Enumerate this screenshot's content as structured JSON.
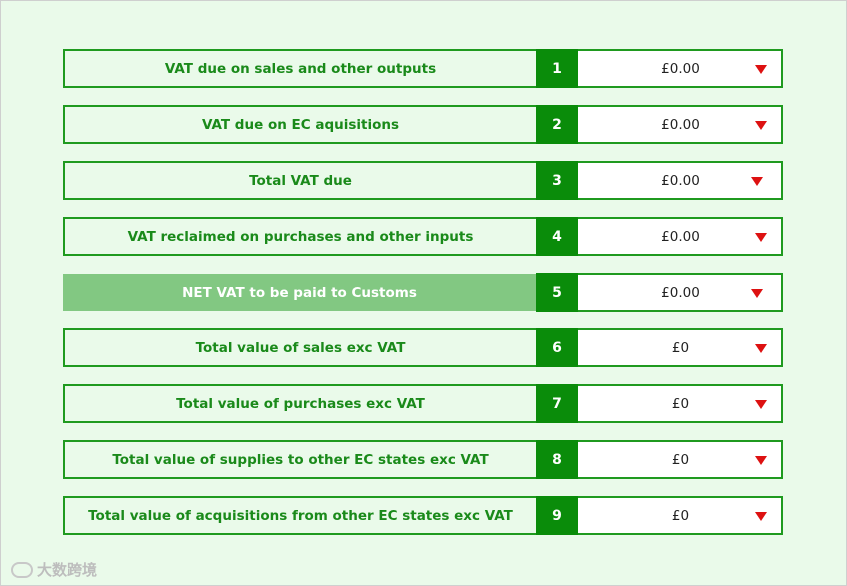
{
  "rows": [
    {
      "label": "VAT due on sales and other outputs",
      "number": "1",
      "value": "£0.00"
    },
    {
      "label": "VAT due on EC aquisitions",
      "number": "2",
      "value": "£0.00"
    },
    {
      "label": "Total VAT due",
      "number": "3",
      "value": "£0.00"
    },
    {
      "label": "VAT reclaimed on purchases and other inputs",
      "number": "4",
      "value": "£0.00"
    },
    {
      "label": "NET VAT to be paid to Customs",
      "number": "5",
      "value": "£0.00"
    },
    {
      "label": "Total value of sales exc VAT",
      "number": "6",
      "value": "£0"
    },
    {
      "label": "Total value of purchases exc VAT",
      "number": "7",
      "value": "£0"
    },
    {
      "label": "Total value of supplies to other EC states exc VAT",
      "number": "8",
      "value": "£0"
    },
    {
      "label": "Total value of acquisitions from other EC states exc VAT",
      "number": "9",
      "value": "£0"
    }
  ],
  "watermark": {
    "text": "大数跨境"
  },
  "colors": {
    "accent_green": "#0a8c0a",
    "border_green": "#1f9a1f",
    "highlight_green": "#82c882",
    "background": "#eafaea",
    "arrow_red": "#dd1111"
  }
}
